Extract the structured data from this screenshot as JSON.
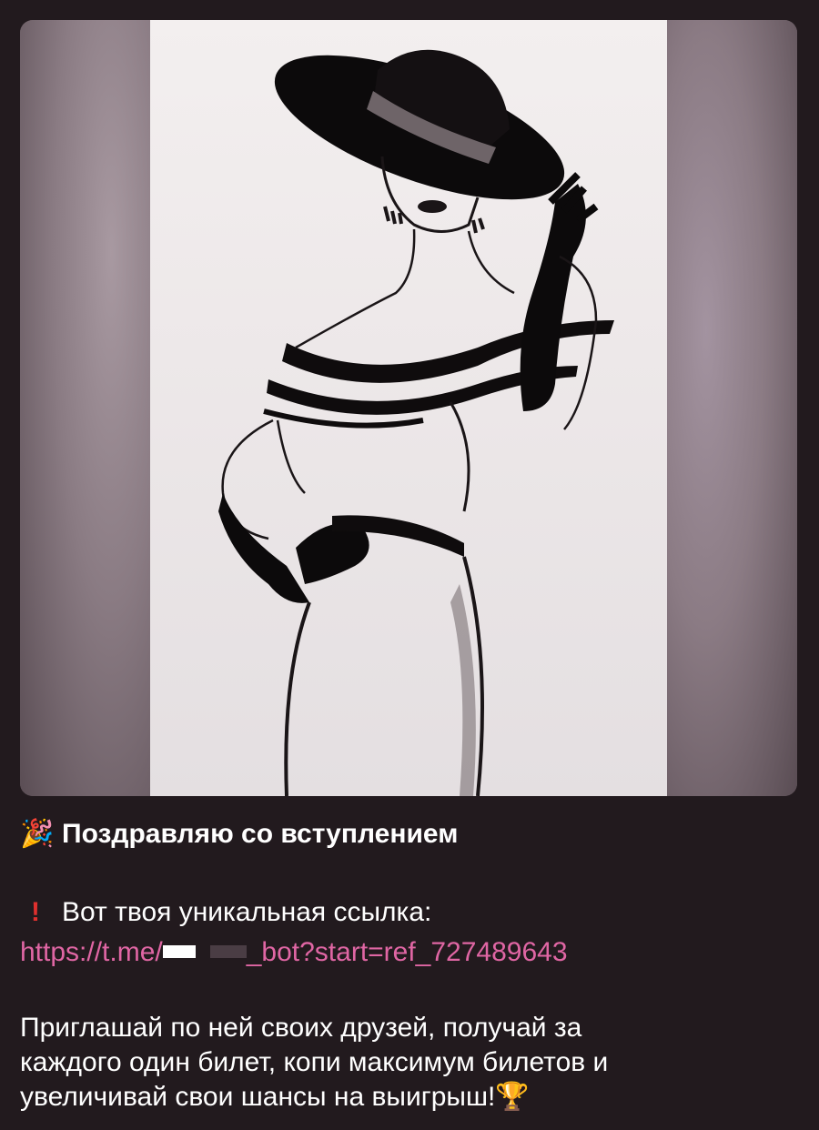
{
  "message": {
    "title": "Поздравляю со вступлением",
    "title_icon": "party-popper-icon",
    "link_intro_icon": "exclamation-icon",
    "link_intro": "Вот твоя уникальная ссылка:",
    "link_prefix": "https://t.me/",
    "link_suffix": "_bot?start=ref_727489643",
    "body_lines": [
      "Приглашай по ней своих друзей, получай за",
      "каждого один билет, копи максимум билетов и",
      "увеличивай свои шансы на выигрыш!"
    ],
    "trophy_icon": "trophy-icon",
    "link_color": "#e066a4"
  }
}
